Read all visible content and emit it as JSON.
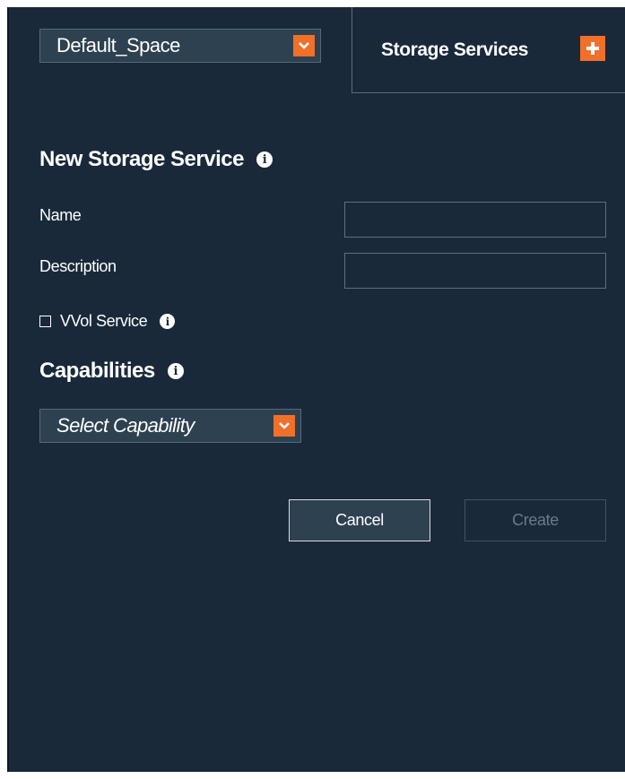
{
  "space_selector": {
    "value": "Default_Space",
    "icon": "chevron-down-icon"
  },
  "tab": {
    "label": "Storage Services",
    "add_icon": "plus-icon"
  },
  "form": {
    "title": "New Storage Service",
    "name_label": "Name",
    "name_value": "",
    "description_label": "Description",
    "description_value": "",
    "vvol_label": "VVol Service",
    "vvol_checked": false,
    "capabilities_title": "Capabilities",
    "capability_select": "Select Capability"
  },
  "buttons": {
    "cancel": "Cancel",
    "create": "Create"
  },
  "colors": {
    "background": "#19293a",
    "accent": "#f0702a",
    "control": "#2e4151"
  }
}
